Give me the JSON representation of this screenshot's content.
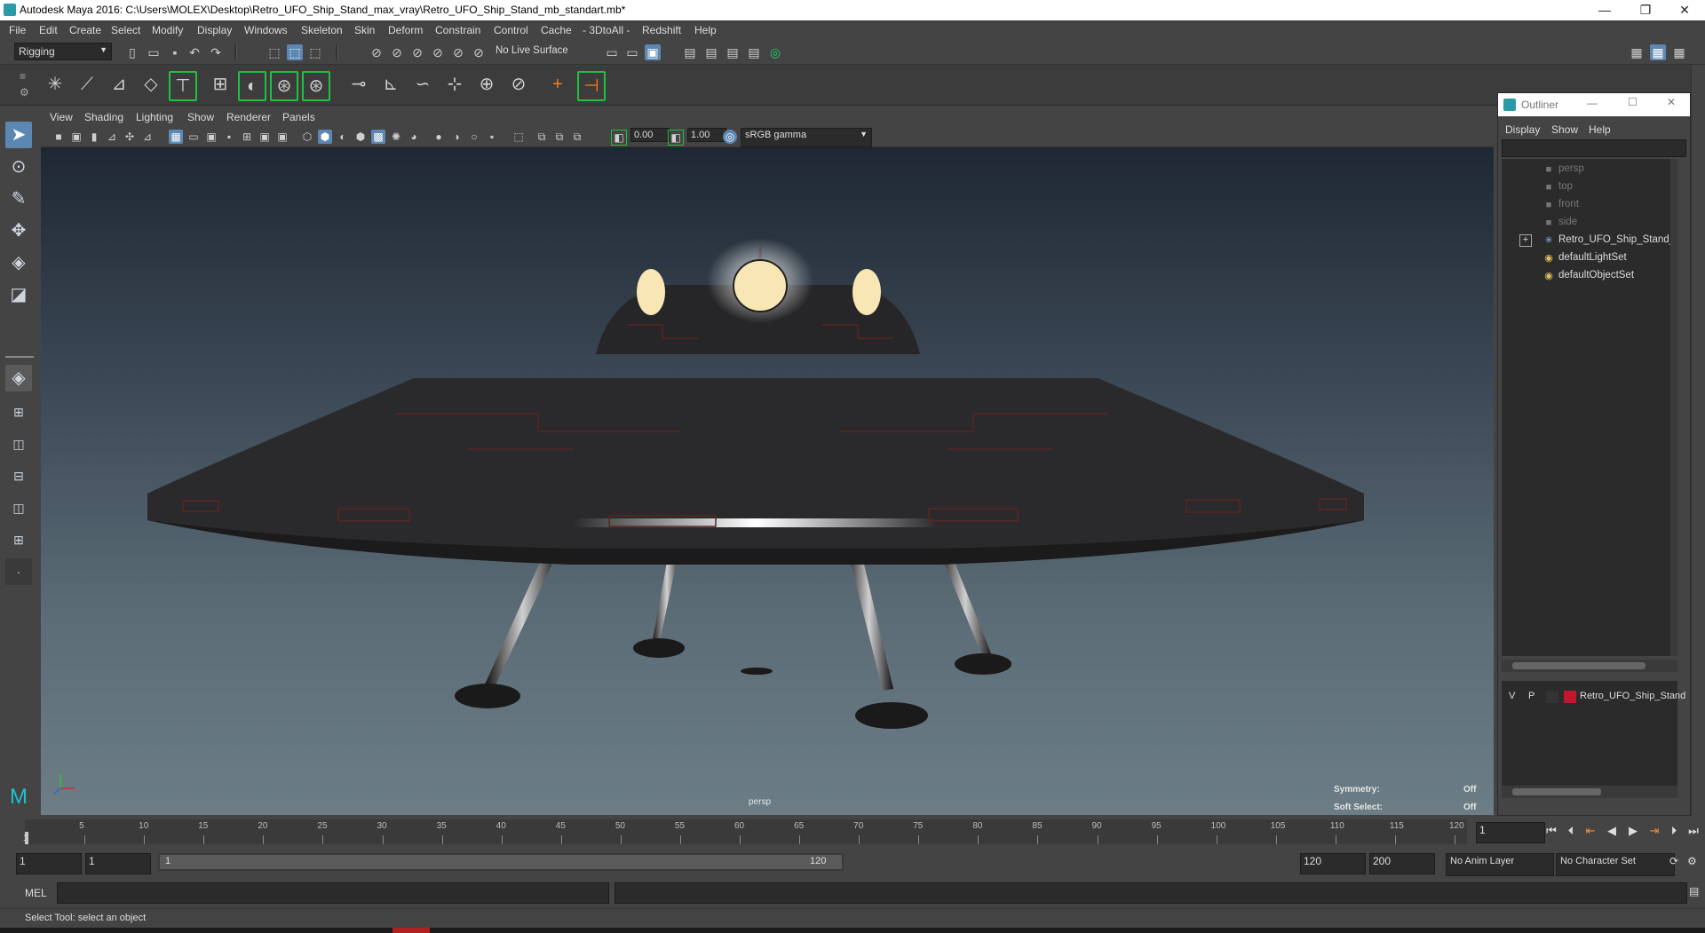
{
  "window": {
    "title": "Autodesk Maya 2016: C:\\Users\\MOLEX\\Desktop\\Retro_UFO_Ship_Stand_max_vray\\Retro_UFO_Ship_Stand_mb_standart.mb*",
    "minimize": "—",
    "restore": "❐",
    "close": "✕"
  },
  "menubar": [
    "File",
    "Edit",
    "Create",
    "Select",
    "Modify",
    "Display",
    "Windows",
    "Skeleton",
    "Skin",
    "Deform",
    "Constrain",
    "Control",
    "Cache",
    "- 3DtoAll -",
    "Redshift",
    "Help"
  ],
  "statusline": {
    "mode": "Rigging",
    "live_surface": "No Live Surface"
  },
  "viewport": {
    "menus": [
      "View",
      "Shading",
      "Lighting",
      "Show",
      "Renderer",
      "Panels"
    ],
    "exposure": "0.00",
    "gamma": "1.00",
    "colorspace": "sRGB gamma",
    "camera_label": "persp",
    "symmetry_label": "Symmetry:",
    "symmetry_value": "Off",
    "soft_select_label": "Soft Select:",
    "soft_select_value": "Off"
  },
  "outliner": {
    "title": "Outliner",
    "menus": [
      "Display",
      "Show",
      "Help"
    ],
    "items": [
      {
        "label": "persp",
        "icon": "camera-icon",
        "dim": true
      },
      {
        "label": "top",
        "icon": "camera-icon",
        "dim": true
      },
      {
        "label": "front",
        "icon": "camera-icon",
        "dim": true
      },
      {
        "label": "side",
        "icon": "camera-icon",
        "dim": true
      },
      {
        "label": "Retro_UFO_Ship_Stand_nc",
        "icon": "joint-icon",
        "dim": false,
        "expandable": true
      },
      {
        "label": "defaultLightSet",
        "icon": "set-icon",
        "dim": false
      },
      {
        "label": "defaultObjectSet",
        "icon": "set-icon",
        "dim": false
      }
    ],
    "layer": {
      "visible": "V",
      "playback": "P",
      "color": "#c0182a",
      "name": "Retro_UFO_Ship_Stand"
    }
  },
  "timeline": {
    "ticks": [
      "5",
      "10",
      "15",
      "20",
      "25",
      "30",
      "35",
      "40",
      "45",
      "50",
      "55",
      "60",
      "65",
      "70",
      "75",
      "80",
      "85",
      "90",
      "95",
      "100",
      "105",
      "110",
      "115",
      "120"
    ],
    "start_label": "1",
    "current_frame": "1"
  },
  "range": {
    "start": "1",
    "playback_start": "1",
    "slider_start": "1",
    "slider_end": "120",
    "playback_end": "120",
    "end": "200",
    "anim_layer": "No Anim Layer",
    "character_set": "No Character Set"
  },
  "command": {
    "language": "MEL"
  },
  "help_line": "Select Tool: select an object",
  "colors": {
    "highlight": "#5d87b3",
    "panel": "#444444",
    "field": "#2b2b2b"
  }
}
